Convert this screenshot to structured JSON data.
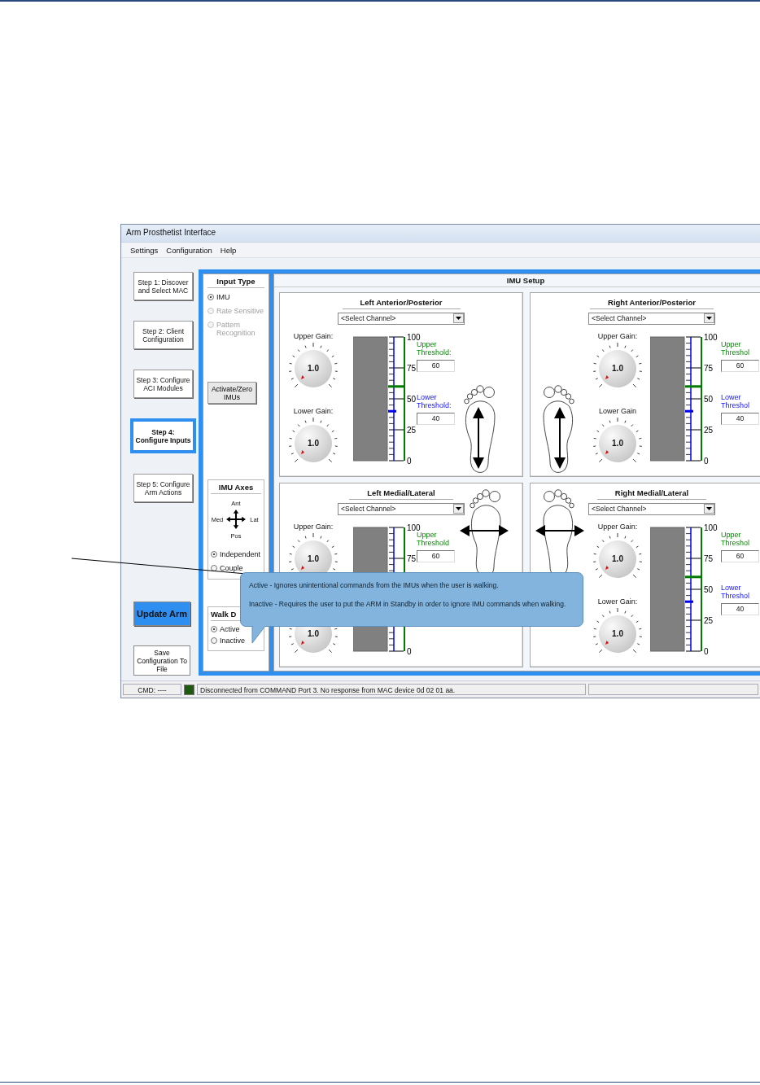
{
  "window": {
    "title": "Arm Prosthetist Interface"
  },
  "menu": [
    "Settings",
    "Configuration",
    "Help"
  ],
  "steps": [
    {
      "label": "Step 1: Discover and Select MAC",
      "selected": false
    },
    {
      "label": "Step 2: Client Configuration",
      "selected": false
    },
    {
      "label": "Step 3: Configure ACI Modules",
      "selected": false
    },
    {
      "label": "Step 4: Configure Inputs",
      "selected": true
    },
    {
      "label": "Step 5: Configure Arm Actions",
      "selected": false
    }
  ],
  "actions": [
    {
      "label": "Update Arm",
      "kind": "primary"
    },
    {
      "label": "Save Configuration To File",
      "kind": "secondary"
    }
  ],
  "input_type": {
    "title": "Input Type",
    "options": [
      {
        "label": "IMU",
        "selected": true,
        "disabled": false
      },
      {
        "label": "Rate Sensitive",
        "selected": false,
        "disabled": true
      },
      {
        "label": "Pattern Recognition",
        "selected": false,
        "disabled": true
      }
    ],
    "button": "Activate/Zero IMUs"
  },
  "imu_axes": {
    "title": "IMU Axes",
    "directions": {
      "top": "Ant",
      "left": "Med",
      "right": "Lat",
      "bottom": "Pos"
    },
    "options": [
      {
        "label": "Independent",
        "selected": true
      },
      {
        "label": "Couple",
        "selected": false
      }
    ]
  },
  "walk": {
    "title": "Walk D",
    "options": [
      {
        "label": "Active",
        "selected": true
      },
      {
        "label": "Inactive",
        "selected": false
      }
    ]
  },
  "imu_setup": {
    "title": "IMU Setup",
    "panels": [
      {
        "title": "Left Anterior/Posterior",
        "kind": "anterior_posterior",
        "channel": "<Select Channel>",
        "gains": [
          {
            "label": "Upper Gain:",
            "value": "1.0"
          },
          {
            "label": "Lower Gain:",
            "value": "1.0"
          }
        ],
        "scale": [
          {
            "label": "100",
            "level": 1
          },
          {
            "label": "75",
            "level": 0.75
          },
          {
            "label": "50",
            "level": 0.5
          },
          {
            "label": "25",
            "level": 0.25
          },
          {
            "label": "0",
            "level": 0
          }
        ],
        "thresholds": [
          {
            "kind": "upper",
            "label": "Upper Threshold:",
            "value": "60",
            "level": 0.6
          },
          {
            "kind": "lower",
            "label": "Lower Threshold:",
            "value": "40",
            "level": 0.4
          }
        ]
      },
      {
        "title": "Right Anterior/Posterior",
        "kind": "anterior_posterior",
        "channel": "<Select Channel>",
        "gains": [
          {
            "label": "Upper Gain:",
            "value": "1.0"
          },
          {
            "label": "Lower Gain",
            "value": "1.0"
          }
        ],
        "scale": [
          {
            "label": "100",
            "level": 1
          },
          {
            "label": "75",
            "level": 0.75
          },
          {
            "label": "50",
            "level": 0.5
          },
          {
            "label": "25",
            "level": 0.25
          },
          {
            "label": "0",
            "level": 0
          }
        ],
        "thresholds": [
          {
            "kind": "upper",
            "label": "Upper Threshol",
            "value": "60",
            "level": 0.6
          },
          {
            "kind": "lower",
            "label": "Lower Threshol",
            "value": "40",
            "level": 0.4
          }
        ]
      },
      {
        "title": "Left Medial/Lateral",
        "kind": "medial_lateral",
        "channel": "<Select Channel>",
        "gains": [
          {
            "label": "Upper Gain:",
            "value": "1.0"
          },
          {
            "value": "1.0"
          }
        ],
        "scale": [
          {
            "label": "100",
            "level": 1
          },
          {
            "label": "75",
            "level": 0.75
          },
          {
            "label": "0",
            "level": 0
          }
        ],
        "thresholds": [
          {
            "kind": "upper",
            "label": "Upper Threshold",
            "value": "60"
          }
        ]
      },
      {
        "title": "Right Medial/Lateral",
        "kind": "medial_lateral",
        "channel": "<Select Channel>",
        "gains": [
          {
            "label": "Upper Gain:",
            "value": "1.0"
          },
          {
            "label": "Lower Gain:",
            "value": "1.0"
          }
        ],
        "scale": [
          {
            "label": "100",
            "level": 1
          },
          {
            "label": "75",
            "level": 0.75
          },
          {
            "label": "50",
            "level": 0.5
          },
          {
            "label": "25",
            "level": 0.25
          },
          {
            "label": "0",
            "level": 0
          }
        ],
        "thresholds": [
          {
            "kind": "upper",
            "label": "Upper Threshol",
            "value": "60",
            "level": 0.6
          },
          {
            "kind": "lower",
            "label": "Lower Threshol",
            "value": "40",
            "level": 0.4
          }
        ]
      }
    ]
  },
  "status_bar": {
    "command": "CMD: ----",
    "message": "Disconnected from COMMAND Port 3.  No response from MAC device 0d 02 01 aa."
  },
  "tooltip": [
    "Active - Ignores unintentional commands from the IMUs when the user is walking.",
    "Inactive - Requires the user to put the ARM in Standby in order to ignore IMU commands when walking."
  ]
}
